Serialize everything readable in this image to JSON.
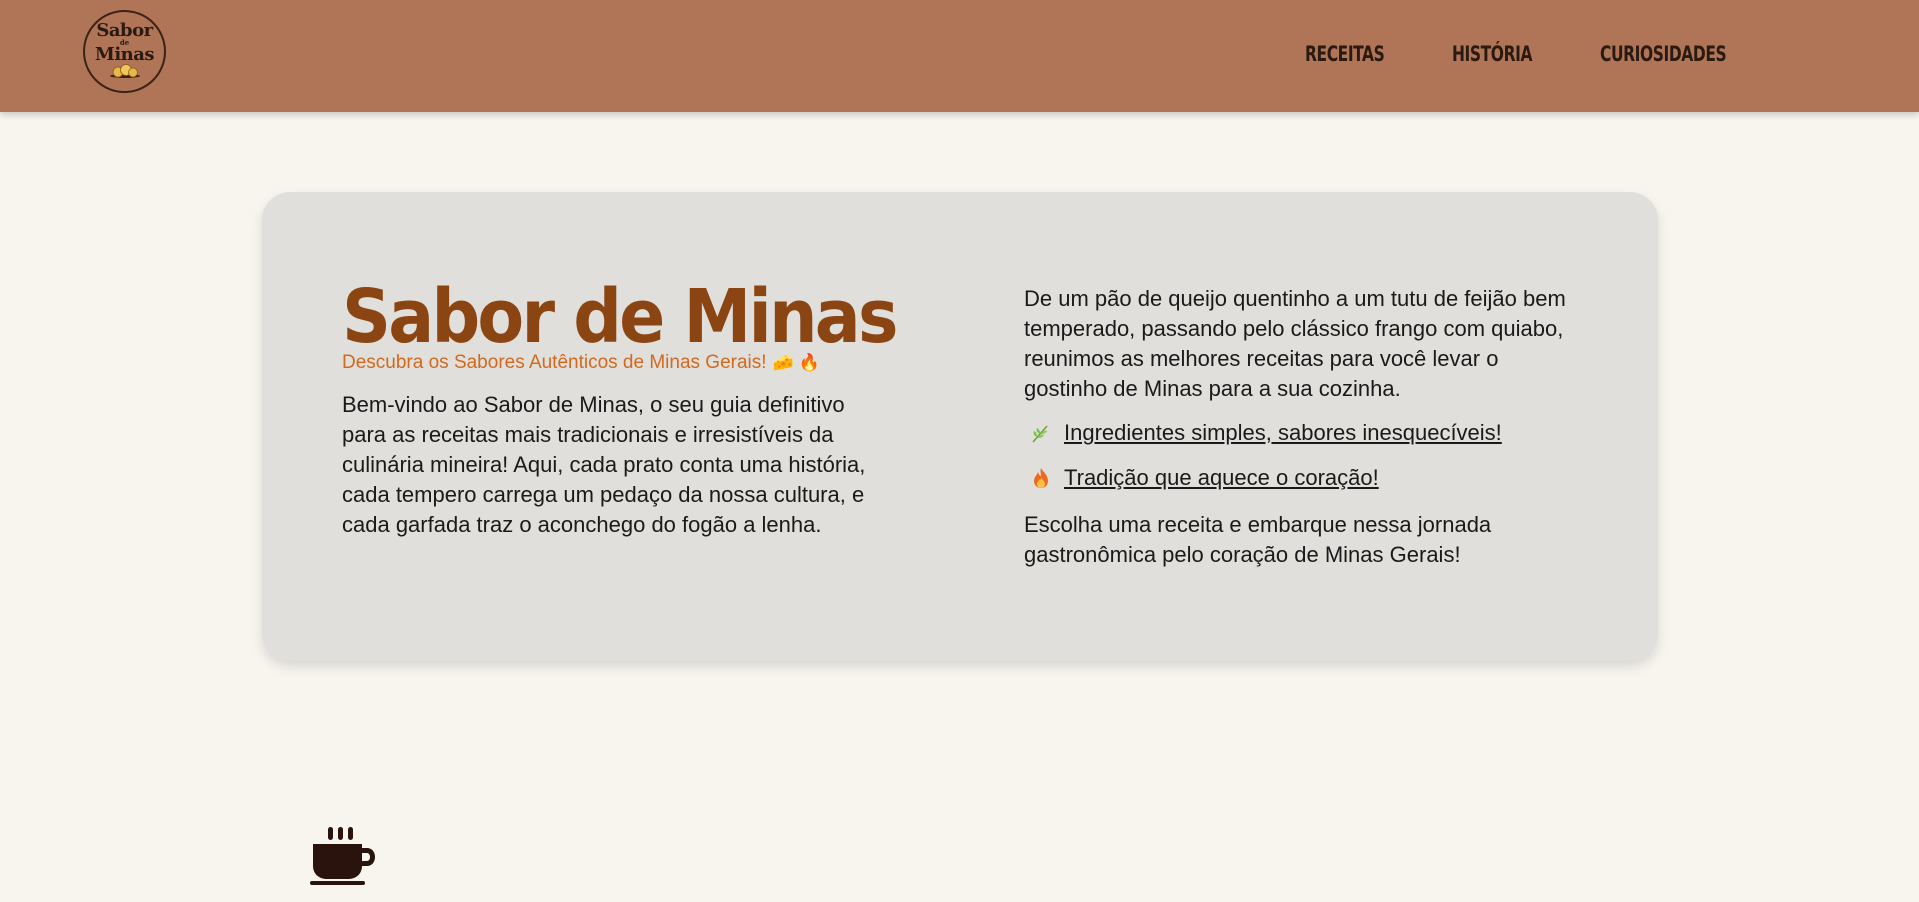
{
  "header": {
    "logo": {
      "line1": "Sabor",
      "small": "de",
      "line2": "Minas",
      "icon": "pao-de-queijo-icon"
    },
    "nav": [
      "RECEITAS",
      "HISTÓRIA",
      "CURIOSIDADES"
    ]
  },
  "hero": {
    "title": "Sabor de Minas",
    "subtitle": "Descubra os Sabores Autênticos de Minas Gerais!",
    "subtitle_emojis": "🧀 🔥",
    "intro": "Bem-vindo ao Sabor de Minas, o seu guia definitivo para as receitas mais tradicionais e irresistíveis da culinária mineira! Aqui, cada prato conta uma história, cada tempero carrega um pedaço da nossa cultura, e cada garfada traz o aconchego do fogão a lenha.",
    "right_paragraph": "De um pão de queijo quentinho a um tutu de feijão bem temperado, passando pelo clássico frango com quiabo, reunimos as melhores receitas para você levar o gostinho de Minas para a sua cozinha.",
    "features": [
      {
        "icon": "herb-icon",
        "text": "Ingredientes simples, sabores inesquecíveis!"
      },
      {
        "icon": "fire-icon",
        "text": "Tradição que aquece o coração!"
      }
    ],
    "closing": "Escolha uma receita e embarque nessa jornada gastronômica pelo coração de Minas Gerais!"
  },
  "footer_icon": "coffee-cup-icon",
  "colors": {
    "header_bg": "#b07456",
    "page_bg": "#f8f5ef",
    "card_bg": "#e0dfdb",
    "title": "#8b4513",
    "subtitle": "#d2691e",
    "nav_text": "#2a1a12"
  }
}
